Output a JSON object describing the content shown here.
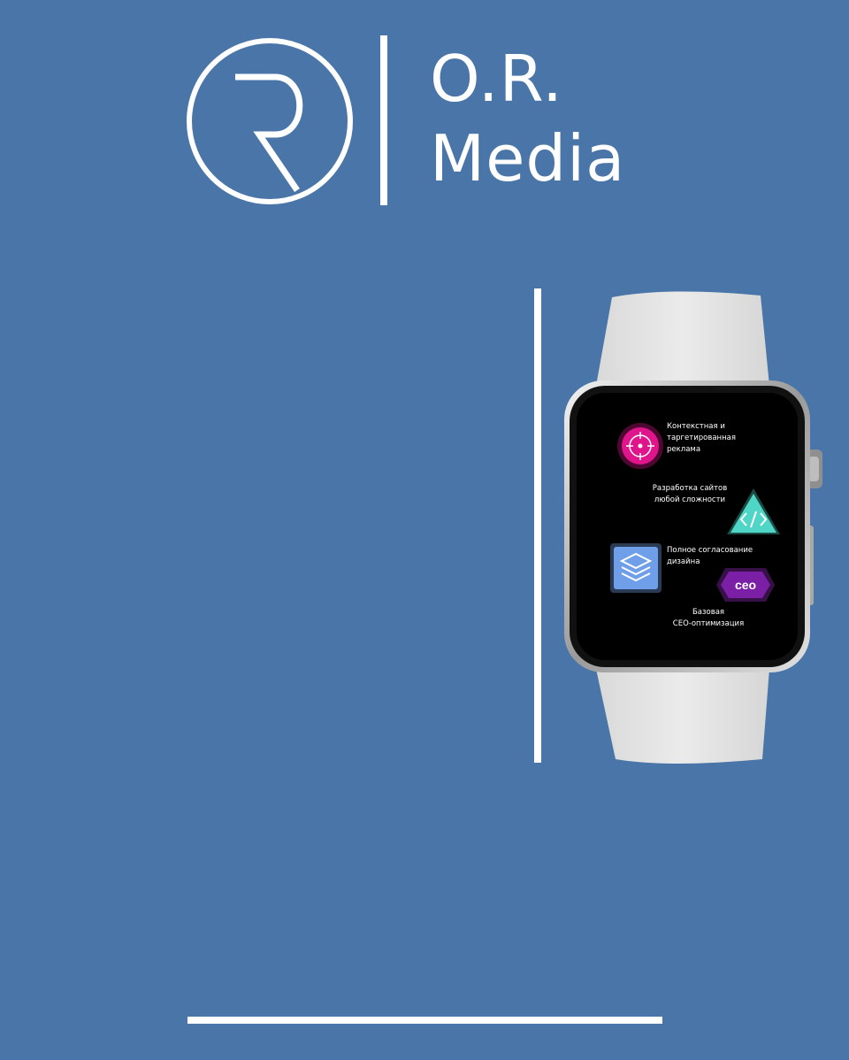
{
  "brand": {
    "line1": "O.R.",
    "line2": "Media"
  },
  "watch_screen": {
    "services": [
      {
        "label": "Контекстная и\nтаргетированная\nреклама",
        "icon": "target-icon"
      },
      {
        "label": "Разработка сайтов\nлюбой сложности",
        "icon": "code-icon"
      },
      {
        "label": "Полное согласование\nдизайна",
        "icon": "layers-icon"
      },
      {
        "label": "Базовая\nСЕО-оптимизация",
        "icon": "ceo-icon",
        "badge": "ceo"
      }
    ]
  },
  "colors": {
    "background": "#4a75a8",
    "line": "#ffffff",
    "watch_band": "#e4e4e4",
    "screen": "#000000",
    "magenta": "#e0158c",
    "teal": "#4fd6c6",
    "blue": "#7aaaf0",
    "purple": "#9b2fc8"
  }
}
